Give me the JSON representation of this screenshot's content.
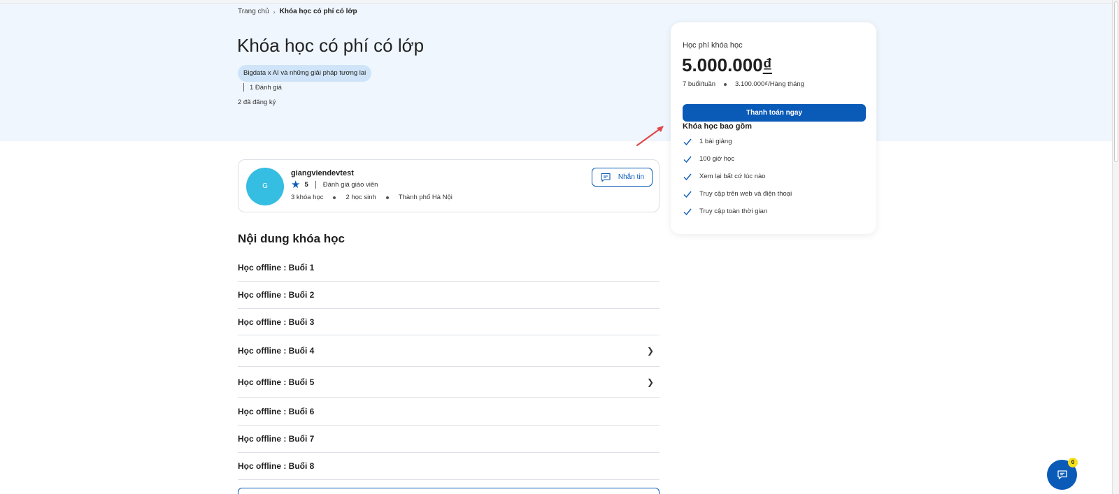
{
  "breadcrumb": {
    "home": "Trang chủ",
    "separator": "›",
    "current": "Khóa học có phí có lớp"
  },
  "course": {
    "title": "Khóa học có phí có lớp",
    "tag": "Bigdata x AI và những giải pháp tương lai",
    "rating_text": "1 Đánh giá",
    "enrolled_text": "2 đã đăng ký"
  },
  "price_card": {
    "label": "Học phí khóa học",
    "price": "5.000.000",
    "currency": "₫",
    "frequency": "7 buổi/tuần",
    "monthly": "3.100.000₫/Hàng tháng",
    "pay_button": "Thanh toán ngay",
    "includes_title": "Khóa học bao gồm",
    "includes": [
      "1 bài giảng",
      "100 giờ học",
      "Xem lại bất cứ lúc nào",
      "Truy cập trên web và điện thoại",
      "Truy cập toàn thời gian"
    ]
  },
  "instructor": {
    "avatar_letter": "G",
    "name": "giangviendevtest",
    "rating": "5",
    "rating_label": "Đánh giá giáo viên",
    "courses": "3 khóa học",
    "students": "2 học sinh",
    "location": "Thành phố Hà Nội",
    "message_button": "Nhắn tin"
  },
  "content": {
    "title": "Nội dung khóa học",
    "lessons": [
      {
        "label": "Học offline : Buổi 1",
        "expandable": false
      },
      {
        "label": "Học offline : Buổi 2",
        "expandable": false
      },
      {
        "label": "Học offline : Buổi 3",
        "expandable": false
      },
      {
        "label": "Học offline : Buổi 4",
        "expandable": true
      },
      {
        "label": "Học offline : Buổi 5",
        "expandable": true
      },
      {
        "label": "Học offline : Buổi 6",
        "expandable": false
      },
      {
        "label": "Học offline : Buổi 7",
        "expandable": false
      },
      {
        "label": "Học offline : Buổi 8",
        "expandable": false
      }
    ]
  },
  "chat": {
    "badge_count": "0"
  },
  "colors": {
    "primary": "#0a5ab8",
    "hero_bg": "#eff6fd",
    "avatar": "#35bde2",
    "arrow": "#e04848",
    "badge": "#f5e21b"
  },
  "icons": {
    "check": "check-icon",
    "message": "message-icon",
    "chat": "chat-icon",
    "star": "star-icon",
    "chevron": "chevron-right-icon"
  }
}
